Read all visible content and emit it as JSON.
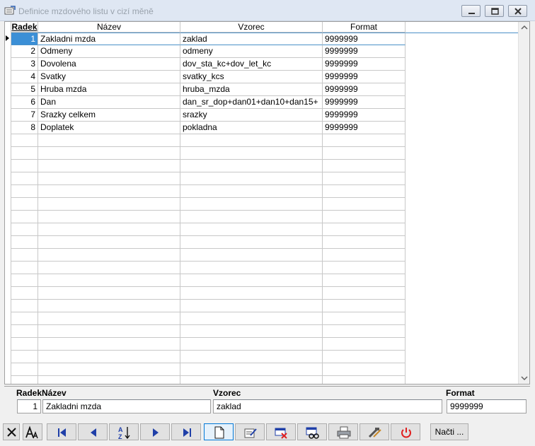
{
  "window": {
    "title": "Definice mzdového listu v cizí měně"
  },
  "grid": {
    "columns": [
      "Radek",
      "Název",
      "Vzorec",
      "Format"
    ],
    "selected_row": 0,
    "rows": [
      {
        "radek": "1",
        "nazev": "Zakladni mzda",
        "vzorec": "zaklad",
        "format": "9999999"
      },
      {
        "radek": "2",
        "nazev": "Odmeny",
        "vzorec": "odmeny",
        "format": "9999999"
      },
      {
        "radek": "3",
        "nazev": "Dovolena",
        "vzorec": "dov_sta_kc+dov_let_kc",
        "format": "9999999"
      },
      {
        "radek": "4",
        "nazev": "Svatky",
        "vzorec": "svatky_kcs",
        "format": "9999999"
      },
      {
        "radek": "5",
        "nazev": "Hruba mzda",
        "vzorec": "hruba_mzda",
        "format": "9999999"
      },
      {
        "radek": "6",
        "nazev": "Dan",
        "vzorec": "dan_sr_dop+dan01+dan10+dan15+",
        "format": "9999999"
      },
      {
        "radek": "7",
        "nazev": "Srazky celkem",
        "vzorec": "srazky",
        "format": "9999999"
      },
      {
        "radek": "8",
        "nazev": "Doplatek",
        "vzorec": "pokladna",
        "format": "9999999"
      }
    ]
  },
  "detail": {
    "radek_label": "Radek",
    "nazev_label": "Název",
    "vzorec_label": "Vzorec",
    "format_label": "Format",
    "radek_value": "1",
    "nazev_value": "Zakladni mzda",
    "vzorec_value": "zaklad",
    "format_value": "9999999"
  },
  "toolbar": {
    "load_label": "Načti ...",
    "icons": [
      "close-icon",
      "font-icon",
      "first-record-icon",
      "previous-record-icon",
      "sort-az-icon",
      "next-record-icon",
      "last-record-icon",
      "new-record-icon",
      "edit-record-icon",
      "delete-record-icon",
      "find-record-icon",
      "print-icon",
      "tools-icon",
      "power-icon"
    ]
  },
  "colors": {
    "selection": "#3b8fd6",
    "titlebar": "#dfe7f3",
    "power_red": "#e02020"
  }
}
